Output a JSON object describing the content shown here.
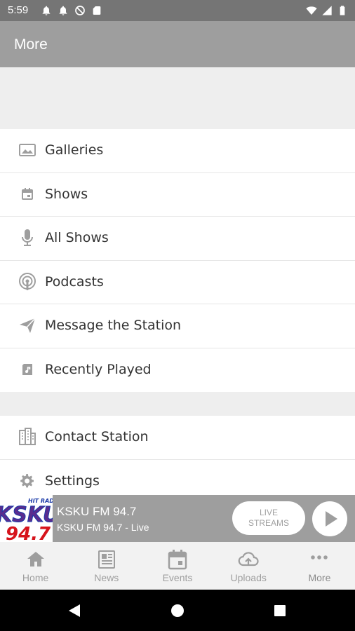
{
  "status_bar": {
    "time": "5:59",
    "left_icons": [
      "notification-bell-icon",
      "notification-bell-icon",
      "no-entry-icon",
      "sd-card-icon"
    ],
    "right_icons": [
      "wifi-icon",
      "signal-icon",
      "battery-icon"
    ]
  },
  "app_bar": {
    "title": "More"
  },
  "menu": {
    "group1": [
      {
        "label": "Galleries",
        "icon": "image-icon"
      },
      {
        "label": "Shows",
        "icon": "calendar-icon"
      },
      {
        "label": "All Shows",
        "icon": "microphone-icon"
      },
      {
        "label": "Podcasts",
        "icon": "podcast-icon"
      },
      {
        "label": "Message the Station",
        "icon": "send-icon"
      },
      {
        "label": "Recently Played",
        "icon": "music-note-icon"
      }
    ],
    "group2": [
      {
        "label": "Contact Station",
        "icon": "building-icon"
      },
      {
        "label": "Settings",
        "icon": "gear-icon"
      }
    ]
  },
  "player": {
    "logo_text": "KSKU",
    "logo_sub": "94.7",
    "logo_top": "HIT RADIO",
    "title": "KSKU FM 94.7",
    "subtitle": "KSKU FM 94.7 - Live",
    "live_line1": "LIVE",
    "live_line2": "STREAMS"
  },
  "bottom_nav": [
    {
      "label": "Home",
      "icon": "home-icon"
    },
    {
      "label": "News",
      "icon": "newspaper-icon"
    },
    {
      "label": "Events",
      "icon": "calendar-icon"
    },
    {
      "label": "Uploads",
      "icon": "upload-cloud-icon"
    },
    {
      "label": "More",
      "icon": "more-dots-icon"
    }
  ],
  "colors": {
    "status_bar": "#757575",
    "app_bar": "#9e9e9e",
    "icon_gray": "#9e9e9e",
    "text": "#333333"
  }
}
